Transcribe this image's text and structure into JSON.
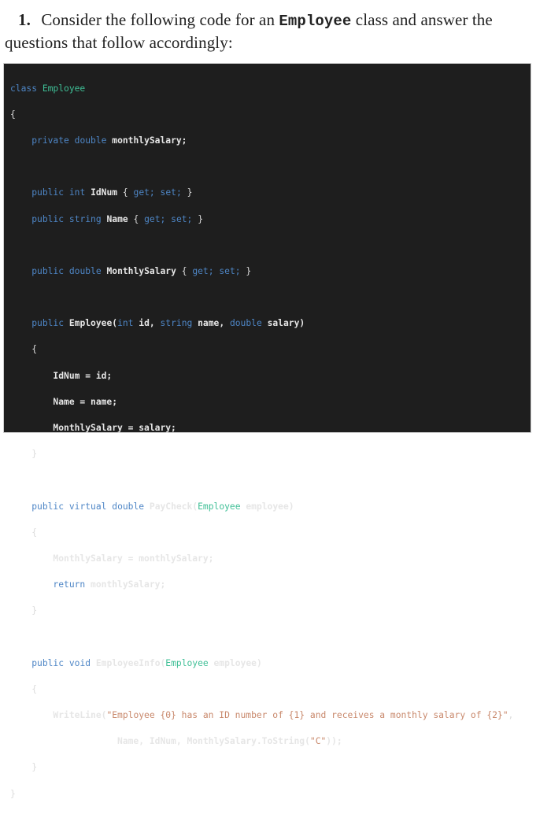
{
  "question": {
    "number": "1.",
    "text_before": "Consider the following code for an",
    "class_name": "Employee",
    "text_after_line1": "class and answer the",
    "text_line2": "questions that follow accordingly:"
  },
  "code": {
    "language": "C#",
    "line_class": {
      "kw": "class",
      "name": "Employee"
    },
    "open_brace": "{",
    "close_brace": "}",
    "field": {
      "mod": "private",
      "type": "double",
      "name": "monthlySalary;"
    },
    "prop_idnum": {
      "mod": "public",
      "type": "int",
      "name": "IdNum",
      "ob": "{",
      "get": "get;",
      "set": "set;",
      "cb": "}"
    },
    "prop_name": {
      "mod": "public",
      "type": "string",
      "name": "Name",
      "ob": "{",
      "get": "get;",
      "set": "set;",
      "cb": "}"
    },
    "prop_salary": {
      "mod": "public",
      "type": "double",
      "name": "MonthlySalary",
      "ob": "{",
      "get": "get;",
      "set": "set;",
      "cb": "}"
    },
    "ctor": {
      "mod": "public",
      "name": "Employee(",
      "p1_type": "int",
      "p1_name": "id,",
      "p2_type": "string",
      "p2_name": "name,",
      "p3_type": "double",
      "p3_name": "salary)",
      "body": [
        "IdNum = id;",
        "Name = name;",
        "MonthlySalary = salary;"
      ]
    },
    "paycheck": {
      "mod1": "public",
      "mod2": "virtual",
      "type": "double",
      "name": "PayCheck(",
      "param_type": "Employee",
      "param_name": "employee)",
      "body_line1": "MonthlySalary = monthlySalary;",
      "return_kw": "return",
      "return_val": "monthlySalary;"
    },
    "info": {
      "mod": "public",
      "type": "void",
      "name": "EmployeeInfo(",
      "param_type": "Employee",
      "param_name": "employee)",
      "call": "WriteLine(",
      "format_string": "\"Employee {0} has an ID number of {1} and receives a monthly salary of {2}\"",
      "comma": ",",
      "args_prefix": "Name, IdNum, MonthlySalary.ToString(",
      "args_str": "\"C\"",
      "args_suffix": "));"
    }
  }
}
